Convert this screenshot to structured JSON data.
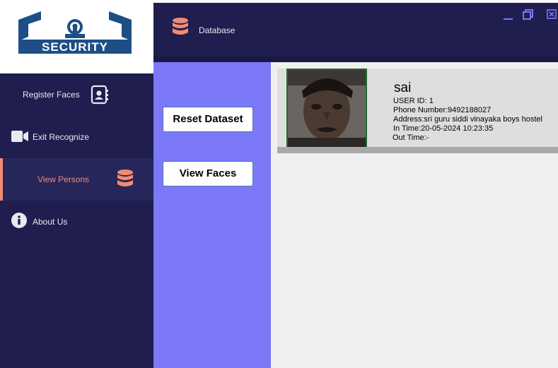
{
  "logo": {
    "text": "SECURITY"
  },
  "sidebar": {
    "items": [
      {
        "label": "Register Faces",
        "icon": "contact-book-icon"
      },
      {
        "label": "Exit Recognize",
        "icon": "video-camera-icon"
      },
      {
        "label": "View Persons",
        "icon": "database-icon",
        "active": true
      },
      {
        "label": "About Us",
        "icon": "info-icon"
      }
    ]
  },
  "header": {
    "title": "Database",
    "icon": "database-icon"
  },
  "window_controls": [
    "minimize-icon",
    "restore-icon",
    "close-icon"
  ],
  "actions": {
    "reset_label": "Reset Dataset",
    "view_label": "View Faces"
  },
  "person": {
    "name": "sai",
    "user_id": "USER ID: 1",
    "phone": "Phone Number:9492188027",
    "address": "Address:sri guru siddi vinayaka boys hostel",
    "in_time": "In Time:20-05-2024 10:23:35",
    "out_time": "Out Time:-"
  },
  "colors": {
    "sidebar": "#1f1e4e",
    "accent": "#f28a72",
    "panel": "#7b79f7",
    "content": "#efefef"
  }
}
